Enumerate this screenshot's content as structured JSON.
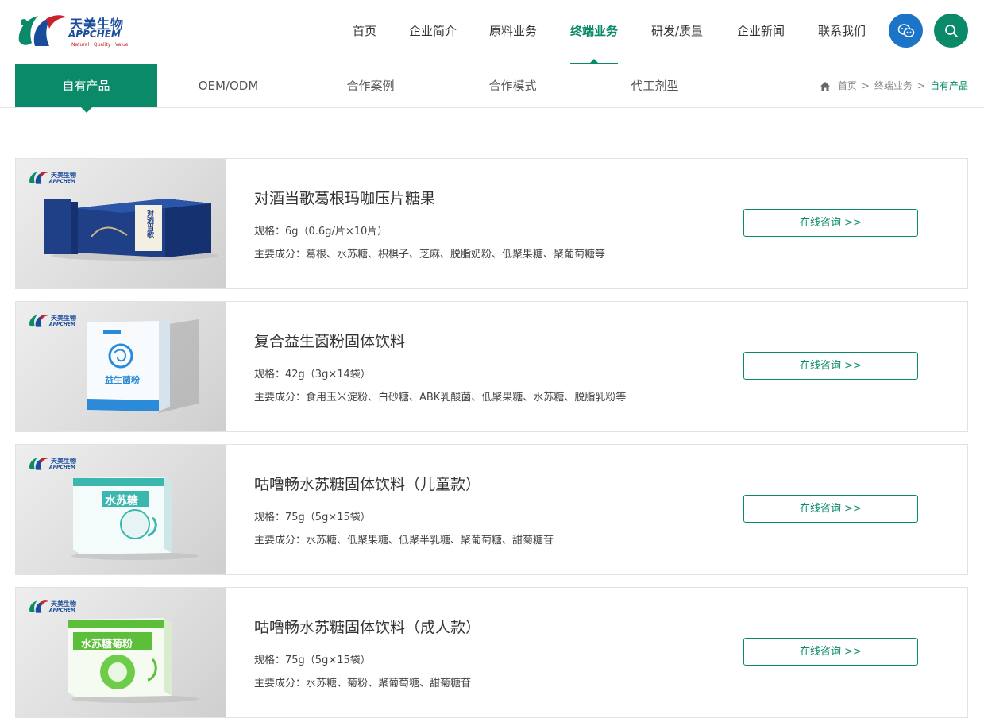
{
  "brand": {
    "name_cn": "天美生物",
    "name_en": "APPCHEM",
    "tagline": "Natural · Quality · Value",
    "colors": {
      "primary": "#0b8a6a",
      "brand_blue": "#1a4c9c",
      "brand_red": "#c8232b",
      "wechat_blue": "#1c74c8"
    }
  },
  "nav": {
    "items": [
      {
        "label": "首页",
        "active": false
      },
      {
        "label": "企业简介",
        "active": false
      },
      {
        "label": "原料业务",
        "active": false
      },
      {
        "label": "终端业务",
        "active": true
      },
      {
        "label": "研发/质量",
        "active": false
      },
      {
        "label": "企业新闻",
        "active": false
      },
      {
        "label": "联系我们",
        "active": false
      }
    ],
    "wechat_icon": "wechat-icon",
    "search_icon": "search-icon"
  },
  "subnav": {
    "items": [
      {
        "label": "自有产品",
        "active": true
      },
      {
        "label": "OEM/ODM",
        "active": false
      },
      {
        "label": "合作案例",
        "active": false
      },
      {
        "label": "合作模式",
        "active": false
      },
      {
        "label": "代工剂型",
        "active": false
      }
    ]
  },
  "breadcrumb": {
    "home_icon": "home-icon",
    "items": [
      "首页",
      "终端业务",
      "自有产品"
    ],
    "separator": ">"
  },
  "products": [
    {
      "title": "对酒当歌葛根玛咖压片糖果",
      "spec": "规格：6g（0.6g/片×10片）",
      "ingredients": "主要成分：葛根、水苏糖、枳椇子、芝麻、脱脂奶粉、低聚果糖、聚葡萄糖等",
      "button": "在线咨询 >>",
      "box_text": "对酒当歌",
      "box_color": "#1f3f86"
    },
    {
      "title": "复合益生菌粉固体饮料",
      "spec": "规格：42g（3g×14袋）",
      "ingredients": "主要成分：食用玉米淀粉、白砂糖、ABK乳酸菌、低聚果糖、水苏糖、脱脂乳粉等",
      "button": "在线咨询 >>",
      "box_text": "益生菌粉",
      "box_color": "#2b8bd8"
    },
    {
      "title": "咕噜畅水苏糖固体饮料（儿童款）",
      "spec": "规格：75g（5g×15袋）",
      "ingredients": "主要成分：水苏糖、低聚果糖、低聚半乳糖、聚葡萄糖、甜菊糖苷",
      "button": "在线咨询 >>",
      "box_text": "水苏糖",
      "box_color": "#3bb7b0"
    },
    {
      "title": "咕噜畅水苏糖固体饮料（成人款）",
      "spec": "规格：75g（5g×15袋）",
      "ingredients": "主要成分：水苏糖、菊粉、聚葡萄糖、甜菊糖苷",
      "button": "在线咨询 >>",
      "box_text": "水苏糖菊粉",
      "box_color": "#5cbf3a"
    }
  ]
}
